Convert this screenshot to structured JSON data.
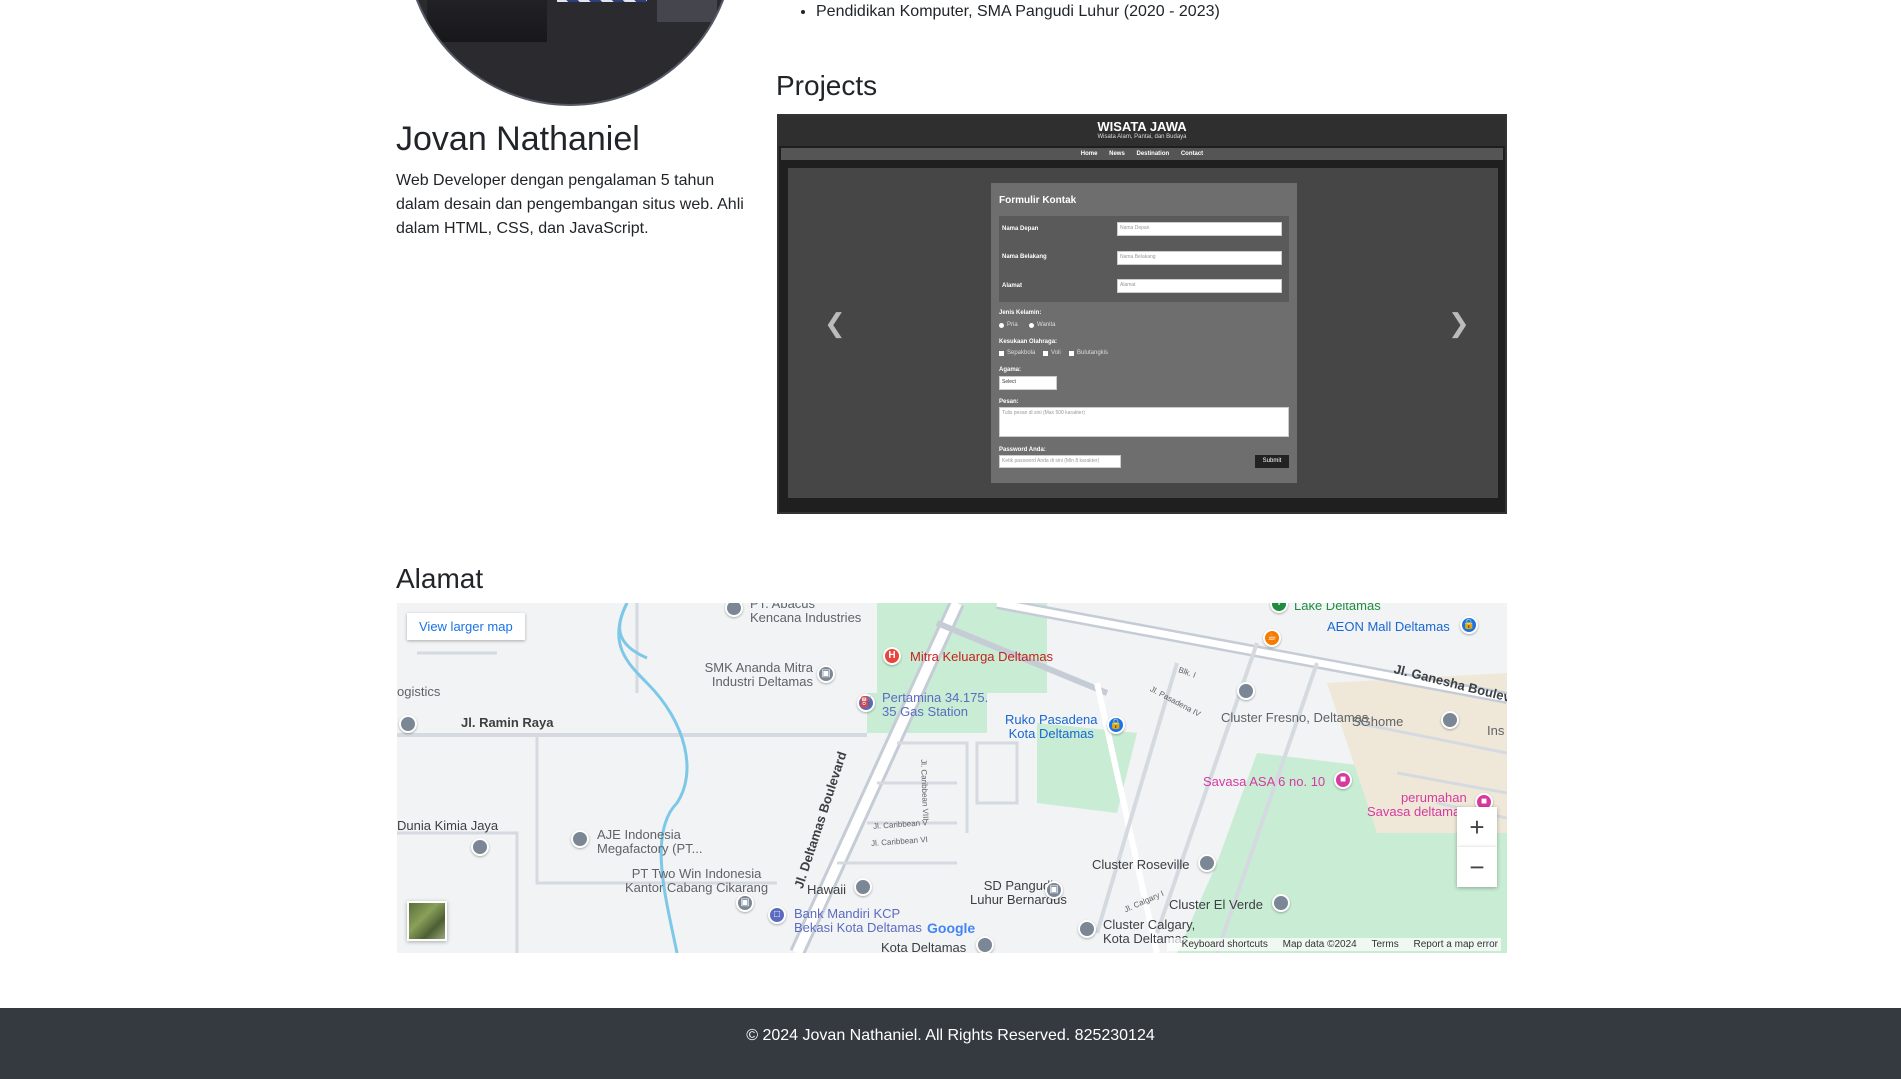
{
  "profile": {
    "name": "Jovan Nathaniel",
    "bio": "Web Developer dengan pengalaman 5 tahun dalam desain dan pengembangan situs web. Ahli dalam HTML, CSS, dan JavaScript."
  },
  "education": {
    "items": [
      "Pendidikan Komputer, SMA Pangudi Luhur (2020 - 2023)"
    ]
  },
  "projects": {
    "heading": "Projects",
    "screenshot": {
      "site_title": "WISATA JAWA",
      "site_subtitle": "Wisata Alam, Pantai, dan Budaya",
      "nav": [
        "Home",
        "News",
        "Destination",
        "Contact"
      ],
      "form": {
        "title": "Formulir Kontak",
        "first_name_label": "Nama Depan",
        "first_name_placeholder": "Nama Depan",
        "last_name_label": "Nama Belakang",
        "last_name_placeholder": "Nama Belakang",
        "address_label": "Alamat",
        "address_placeholder": "Alamat",
        "gender_label": "Jenis Kelamin:",
        "gender_options": [
          "Pria",
          "Wanita"
        ],
        "sport_label": "Kesukaan Olahraga:",
        "sport_options": [
          "Sepakbola",
          "Voli",
          "Bulutangkis"
        ],
        "religion_label": "Agama:",
        "religion_value": "Select",
        "message_label": "Pesan:",
        "message_placeholder": "Tulis pesan di sini (Max 500 karakter)",
        "password_label": "Password Anda:",
        "password_placeholder": "Ketik password Anda di sini (Min 8 karakter)",
        "submit_label": "Submit"
      }
    }
  },
  "address": {
    "heading": "Alamat",
    "map": {
      "view_larger": "View larger map",
      "zoom_in": "+",
      "zoom_out": "−",
      "pois": {
        "abacus": "PT. Abacus\nKencana Industries",
        "smk": "SMK Ananda Mitra\nIndustri Deltamas",
        "logistics": "ogistics",
        "ramin": "Jl. Ramin Raya",
        "mitra": "Mitra Keluarga Deltamas",
        "pertamina": "Pertamina 34.175.\n35 Gas Station",
        "ruko": "Ruko Pasadena\nKota Deltamas",
        "lake": "Lake Deltamas",
        "aeon": "AEON Mall Deltamas",
        "ganesha": "Jl. Ganesha Boulevard",
        "fresno": "Cluster Fresno, Deltamas",
        "sghome": "SGhome",
        "ins": "Ins",
        "savasa_asa": "Savasa ASA 6 no. 10",
        "perumahan": "perumahan\nSavasa deltamas",
        "dunia": "Dunia Kimia Jaya",
        "aje": "AJE Indonesia\nMegafactory (PT...",
        "twowin": "PT Two Win Indonesia\nKantor Cabang Cikarang",
        "deltamas_blvd": "Jl. Deltamas Boulevard",
        "hawaii": "Hawaii",
        "sdpangudi": "SD Pangudi\nLuhur Bernardus",
        "roseville": "Cluster Roseville",
        "elverde": "Cluster El Verde",
        "calgary": "Cluster Calgary,\nKota Deltamas",
        "mandiri": "Bank Mandiri KCP\nBekasi Kota Deltamas",
        "kota": "Kota Deltamas",
        "caribbean5": "Jl. Caribbean V",
        "caribbean6": "Jl. Caribbean VI",
        "caribbean8": "Jl. Caribbean VIII",
        "pasadena4": "Jl. Pasadena IV",
        "calgary1": "Jl. Calgary I",
        "blk": "Blk. I"
      },
      "logo": "Google",
      "attribution": [
        "Keyboard shortcuts",
        "Map data ©2024",
        "Terms",
        "Report a map error"
      ]
    }
  },
  "footer": {
    "text": "© 2024 Jovan Nathaniel. All Rights Reserved. 825230124"
  },
  "colors": {
    "footer_bg": "#343a40",
    "link_blue": "#1a73e8",
    "hospital_red": "#e8453c",
    "park_green": "#c8ecd4"
  }
}
